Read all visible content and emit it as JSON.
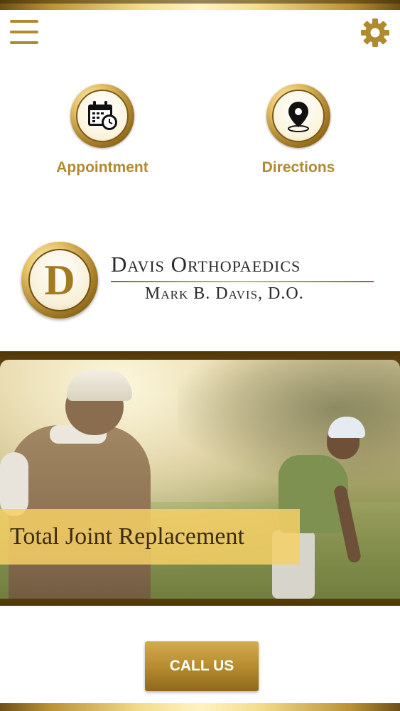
{
  "header": {
    "menu_icon": "hamburger-menu-icon",
    "settings_icon": "gear-icon"
  },
  "quick_actions": [
    {
      "label": "Appointment",
      "icon": "calendar-clock-icon"
    },
    {
      "label": "Directions",
      "icon": "map-pin-icon"
    }
  ],
  "logo": {
    "seal_letter": "D",
    "name": "Davis Orthopaedics",
    "doctor": "Mark B. Davis, D.O."
  },
  "hero": {
    "caption": "Total Joint Replacement"
  },
  "cta": {
    "call_label": "CALL US"
  },
  "colors": {
    "gold": "#b08a2e",
    "dark_gold": "#6e4f15",
    "light_gold": "#f4dc8a",
    "button_text": "#ffffff"
  }
}
